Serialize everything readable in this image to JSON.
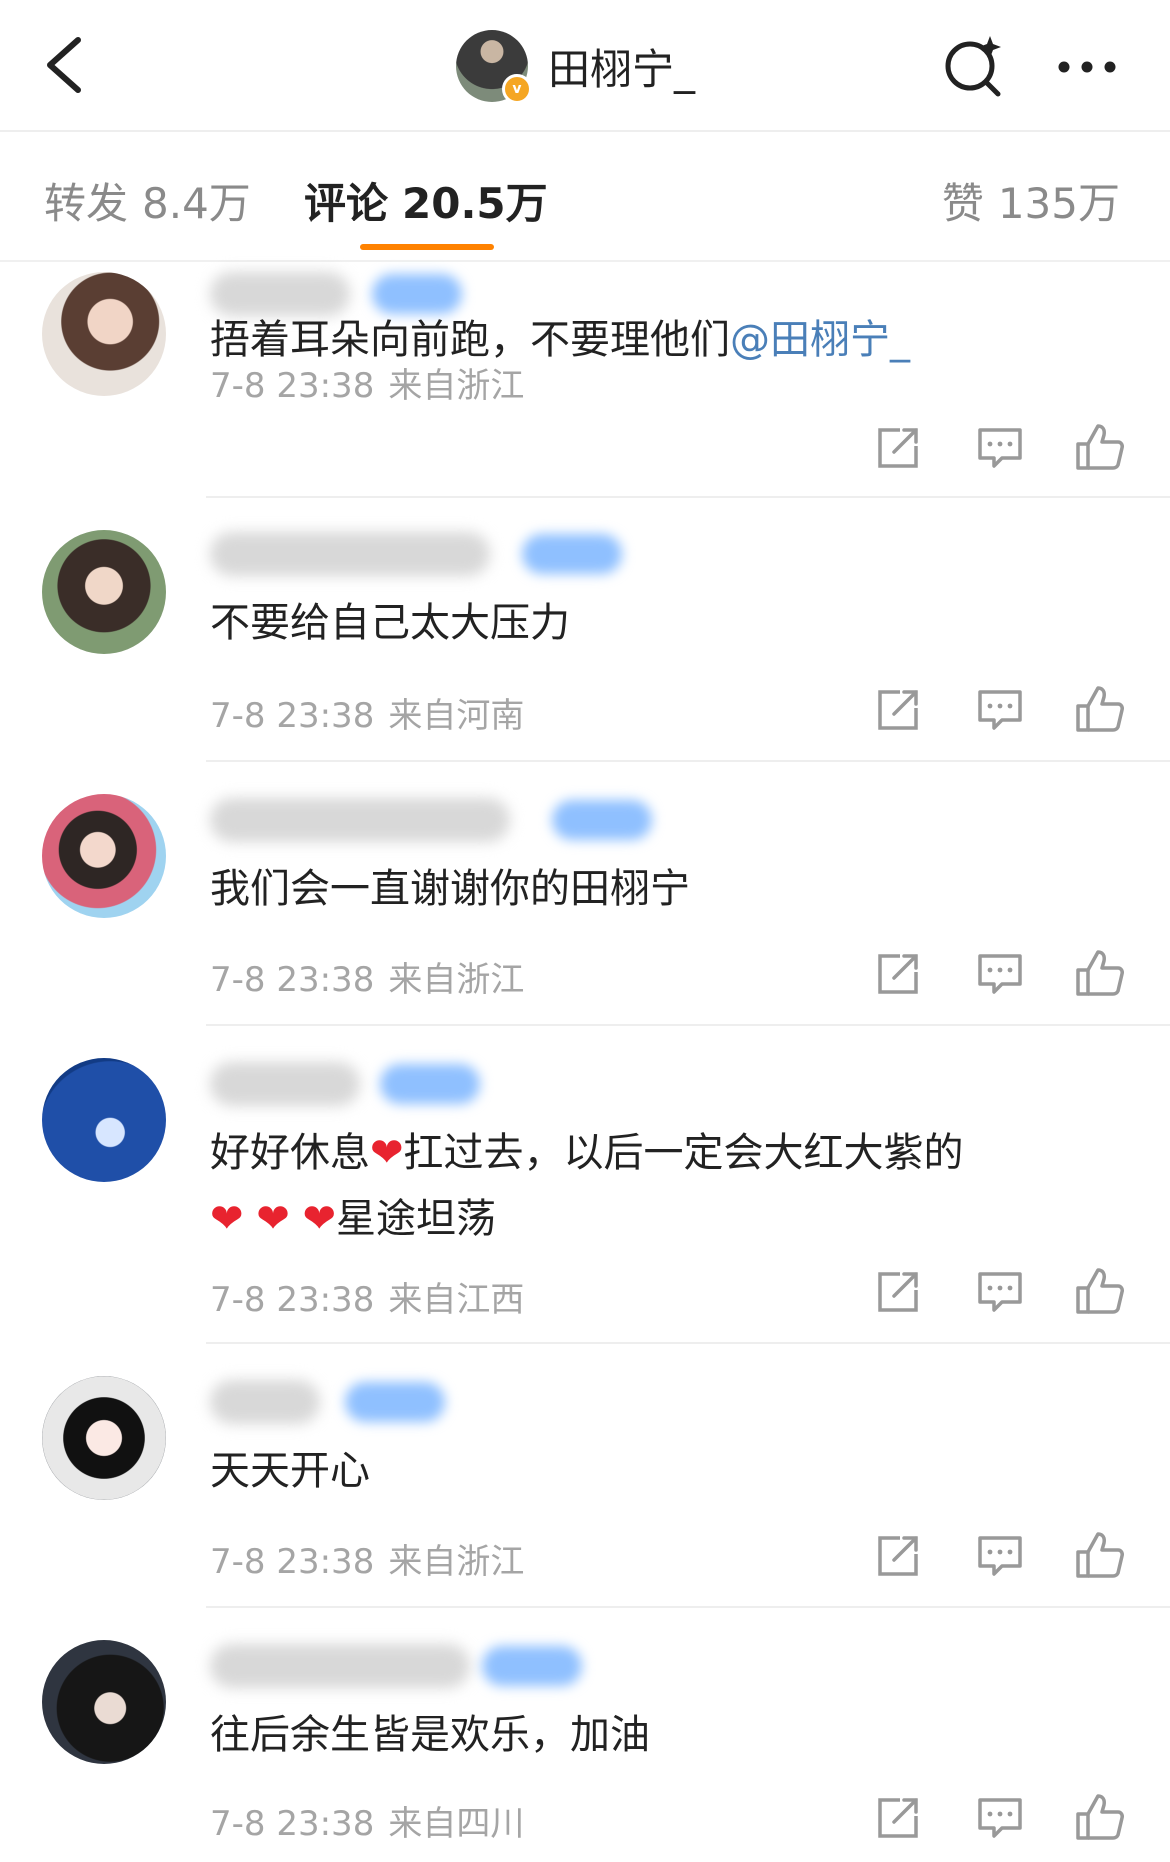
{
  "header": {
    "title": "田栩宁_",
    "verified_badge": "v",
    "back_icon": "chevron-left-icon",
    "search_icon": "search-sparkle-icon",
    "more_icon": "more-dots-icon"
  },
  "tabs": {
    "repost": {
      "label": "转发",
      "count": "8.4万"
    },
    "comment": {
      "label": "评论",
      "count": "20.5万"
    },
    "like": {
      "label": "赞",
      "count": "135万"
    }
  },
  "colors": {
    "accent": "#ff8200",
    "mention": "#4a7fb8",
    "meta": "#a5a5a5"
  },
  "comments": [
    {
      "text_before": "捂着耳朵向前跑，不要理他们",
      "mention": "@田栩宁_",
      "time": "7-8 23:38",
      "location": "来自浙江"
    },
    {
      "text": "不要给自己太大压力",
      "time": "7-8 23:38",
      "location": "来自河南"
    },
    {
      "text": "我们会一直谢谢你的田栩宁",
      "time": "7-8 23:38",
      "location": "来自浙江"
    },
    {
      "text_part1": "好好休息",
      "heart": "❤",
      "text_part2": "扛过去，以后一定会大红大紫的",
      "hearts": "❤ ❤ ❤",
      "text_part3": "星途坦荡",
      "time": "7-8 23:38",
      "location": "来自江西"
    },
    {
      "text": "天天开心",
      "time": "7-8 23:38",
      "location": "来自浙江"
    },
    {
      "text": "往后余生皆是欢乐，加油",
      "time": "7-8 23:38",
      "location": "来自四川"
    }
  ],
  "actions": {
    "share_icon": "share-icon",
    "reply_icon": "comment-icon",
    "like_icon": "thumbs-up-icon"
  }
}
